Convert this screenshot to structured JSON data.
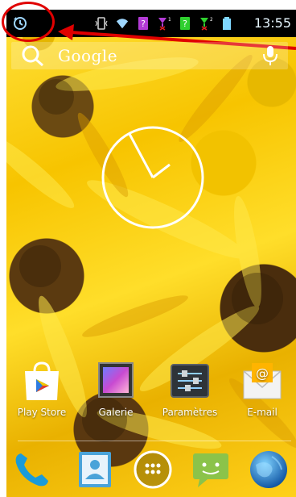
{
  "status_bar": {
    "time": "13:55",
    "left_icon": "sync-icon",
    "icons": [
      "vibrate-icon",
      "wifi-icon",
      "sim1-question-icon",
      "signal-1-icon",
      "sim2-question-icon",
      "signal-2-icon",
      "battery-icon"
    ],
    "sim1_badge": "1",
    "sim2_badge": "2"
  },
  "search": {
    "text": "Google",
    "icon": "search-icon",
    "mic": "microphone-icon"
  },
  "clock": {
    "type": "analog"
  },
  "apps": [
    {
      "label": "Play Store",
      "icon": "play-store-icon"
    },
    {
      "label": "Galerie",
      "icon": "gallery-icon"
    },
    {
      "label": "Paramètres",
      "icon": "settings-icon"
    },
    {
      "label": "E-mail",
      "icon": "email-icon"
    }
  ],
  "dock": [
    {
      "name": "phone",
      "icon": "phone-icon"
    },
    {
      "name": "contacts",
      "icon": "contacts-icon"
    },
    {
      "name": "all-apps",
      "icon": "apps-grid-icon"
    },
    {
      "name": "messaging",
      "icon": "messaging-icon"
    },
    {
      "name": "browser",
      "icon": "globe-icon"
    }
  ],
  "colors": {
    "annotation": "#e00000",
    "status_bg": "#000000",
    "time": "#e6f6ff",
    "sim1": "#b33bd6",
    "sim2": "#2fd02f"
  }
}
